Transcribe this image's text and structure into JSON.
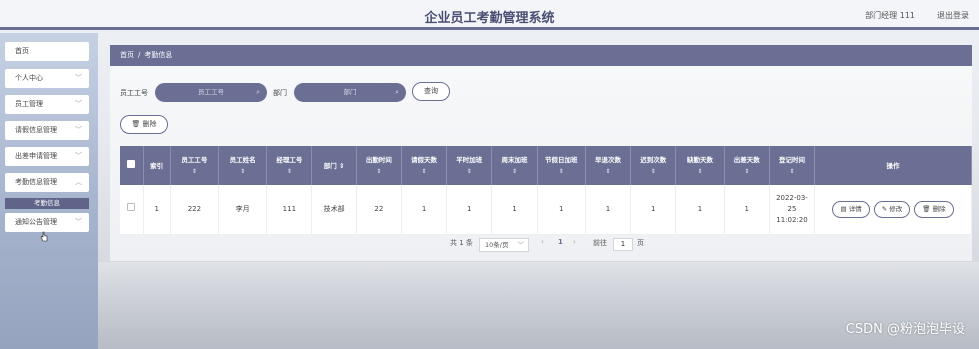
{
  "header": {
    "title": "企业员工考勤管理系统",
    "user": "部门经理 111",
    "logout": "退出登录"
  },
  "sidebar": {
    "items": [
      {
        "label": "首页",
        "has_chevron": false
      },
      {
        "label": "个人中心",
        "has_chevron": true
      },
      {
        "label": "员工管理",
        "has_chevron": true
      },
      {
        "label": "请假信息管理",
        "has_chevron": true
      },
      {
        "label": "出差申请管理",
        "has_chevron": true
      },
      {
        "label": "考勤信息管理",
        "has_chevron": true
      },
      {
        "label": "通知公告管理",
        "has_chevron": true
      }
    ],
    "active_sub": "考勤信息"
  },
  "breadcrumb": {
    "home": "首页",
    "sep": "/",
    "current": "考勤信息"
  },
  "search": {
    "emp_label": "员工工号",
    "emp_placeholder": "员工工号",
    "dept_label": "部门",
    "dept_placeholder": "部门",
    "query_button": "查询",
    "delete_button": "删除"
  },
  "table": {
    "columns": [
      "索引",
      "员工工号",
      "员工姓名",
      "经理工号",
      "部门",
      "出勤时间",
      "请假天数",
      "平时加班",
      "周末加班",
      "节假日加班",
      "早退次数",
      "迟到次数",
      "缺勤天数",
      "出差天数",
      "登记时间",
      "操作"
    ],
    "rows": [
      [
        "1",
        "222",
        "李月",
        "111",
        "技术部",
        "22",
        "1",
        "1",
        "1",
        "1",
        "1",
        "1",
        "1",
        "1",
        "2022-03-25 11:02:20"
      ]
    ],
    "actions": {
      "detail": "详情",
      "edit": "修改",
      "delete": "删除"
    }
  },
  "pagination": {
    "total": "共 1 条",
    "page_size": "10条/页",
    "current_page": "1",
    "goto_label": "前往",
    "goto_value": "1",
    "page_suffix": "页"
  },
  "watermark": "CSDN @粉泡泡毕设",
  "colors": {
    "accent": "#6a6f93",
    "header_bg": "#f3f5f8"
  }
}
